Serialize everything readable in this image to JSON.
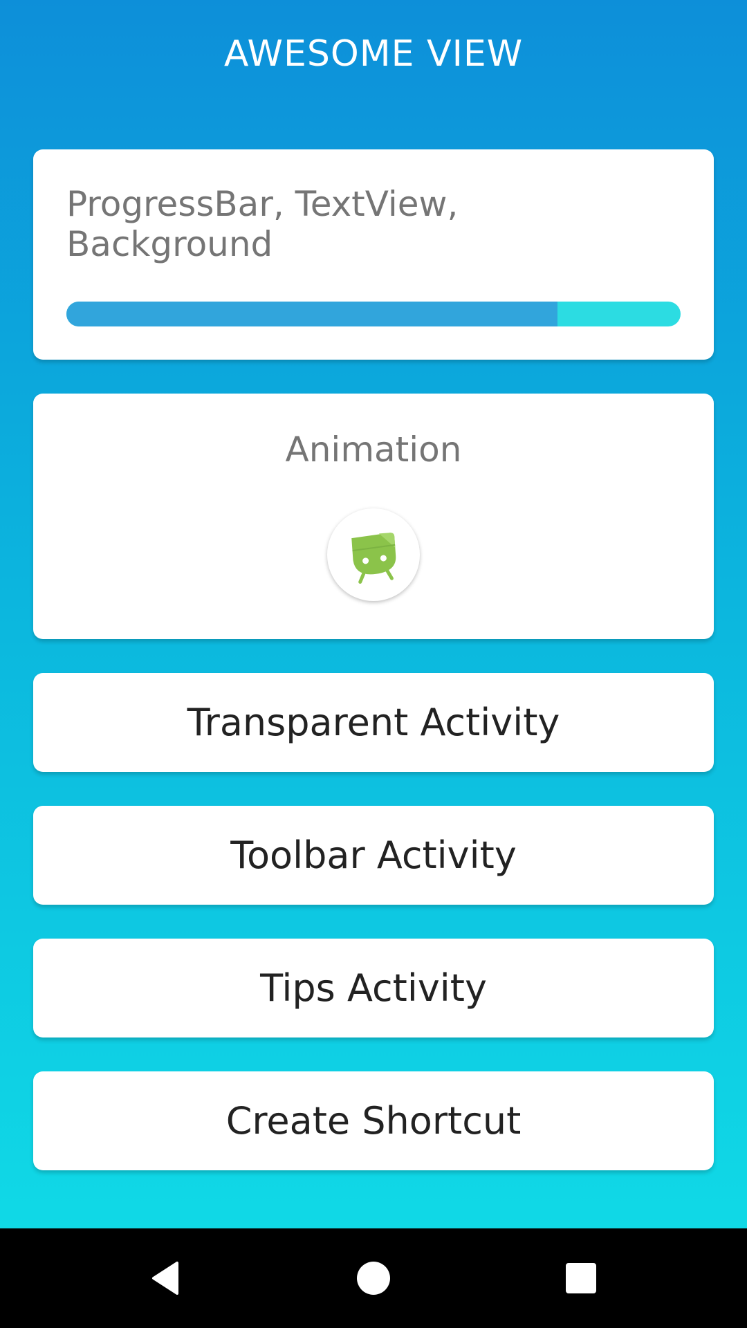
{
  "app": {
    "title": "AWESOME VIEW"
  },
  "progress_card": {
    "label": "ProgressBar, TextView, Background",
    "progress_percent": 80,
    "fill_color": "#31A5DC",
    "track_color": "#2CDCE2"
  },
  "animation_card": {
    "label": "Animation",
    "icon": "android-icon"
  },
  "buttons": [
    {
      "label": "Transparent Activity"
    },
    {
      "label": "Toolbar Activity"
    },
    {
      "label": "Tips Activity"
    },
    {
      "label": "Create Shortcut"
    }
  ],
  "colors": {
    "gradient_top": "#0D8FD9",
    "gradient_bottom": "#10D9E6",
    "card": "#FFFFFF",
    "android_green": "#8BC34A"
  },
  "navbar": {
    "back": "back-icon",
    "home": "home-icon",
    "recents": "recents-icon"
  }
}
